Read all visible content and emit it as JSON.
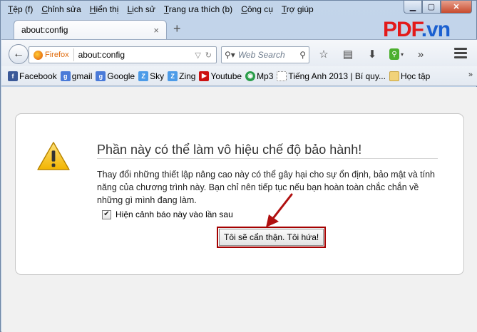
{
  "menubar": [
    "Tệp (f)",
    "Chỉnh sửa",
    "Hiển thị",
    "Lịch sử",
    "Trang ưa thích (b)",
    "Công cụ",
    "Trợ giúp"
  ],
  "tab": {
    "title": "about:config",
    "close": "×",
    "new_tab": "+"
  },
  "logo": {
    "pdf": "PDF",
    "dot": ".",
    "vn": "vn"
  },
  "navbar": {
    "identity": "Firefox",
    "url": "about:config",
    "search_placeholder": "Web Search"
  },
  "bookmarks": [
    {
      "label": "Facebook",
      "icon": "facebook-icon",
      "color": "#3b5998",
      "glyph": "f"
    },
    {
      "label": "gmail",
      "icon": "google-icon",
      "color": "#4a7ad8",
      "glyph": "g"
    },
    {
      "label": "Google",
      "icon": "google-icon",
      "color": "#4a7ad8",
      "glyph": "g"
    },
    {
      "label": "Sky",
      "icon": "zing-icon",
      "color": "#4c9be8",
      "glyph": "Z"
    },
    {
      "label": "Zing",
      "icon": "zing-icon",
      "color": "#4c9be8",
      "glyph": "Z"
    },
    {
      "label": "Youtube",
      "icon": "youtube-icon",
      "color": "#cc1111",
      "glyph": "▶"
    },
    {
      "label": "Mp3",
      "icon": "mp3-icon",
      "color": "#2a9d4a",
      "glyph": "◉"
    },
    {
      "label": "Tiếng Anh 2013 | Bí quy...",
      "icon": "page-icon",
      "color": "#ffffff",
      "glyph": ""
    },
    {
      "label": "Học tập",
      "icon": "folder-icon",
      "color": "#f1d27a",
      "glyph": ""
    }
  ],
  "warning": {
    "title": "Phần này có thể làm vô hiệu chế độ bảo hành!",
    "body": "Thay đổi những thiết lập nâng cao này có thể gây hại cho sự ổn định, bảo mật và tính năng của chương trình này. Bạn chỉ nên tiếp tục nếu bạn hoàn toàn chắc chắn về những gì mình đang làm.",
    "checkbox_label": "Hiện cảnh báo này vào lần sau",
    "checkbox_checked": true,
    "confirm_button": "Tôi sẽ cẩn thận. Tôi hứa!"
  },
  "colors": {
    "highlight_border": "#a40000",
    "logo_red": "#e31a1a",
    "logo_blue": "#1a5fd0"
  }
}
